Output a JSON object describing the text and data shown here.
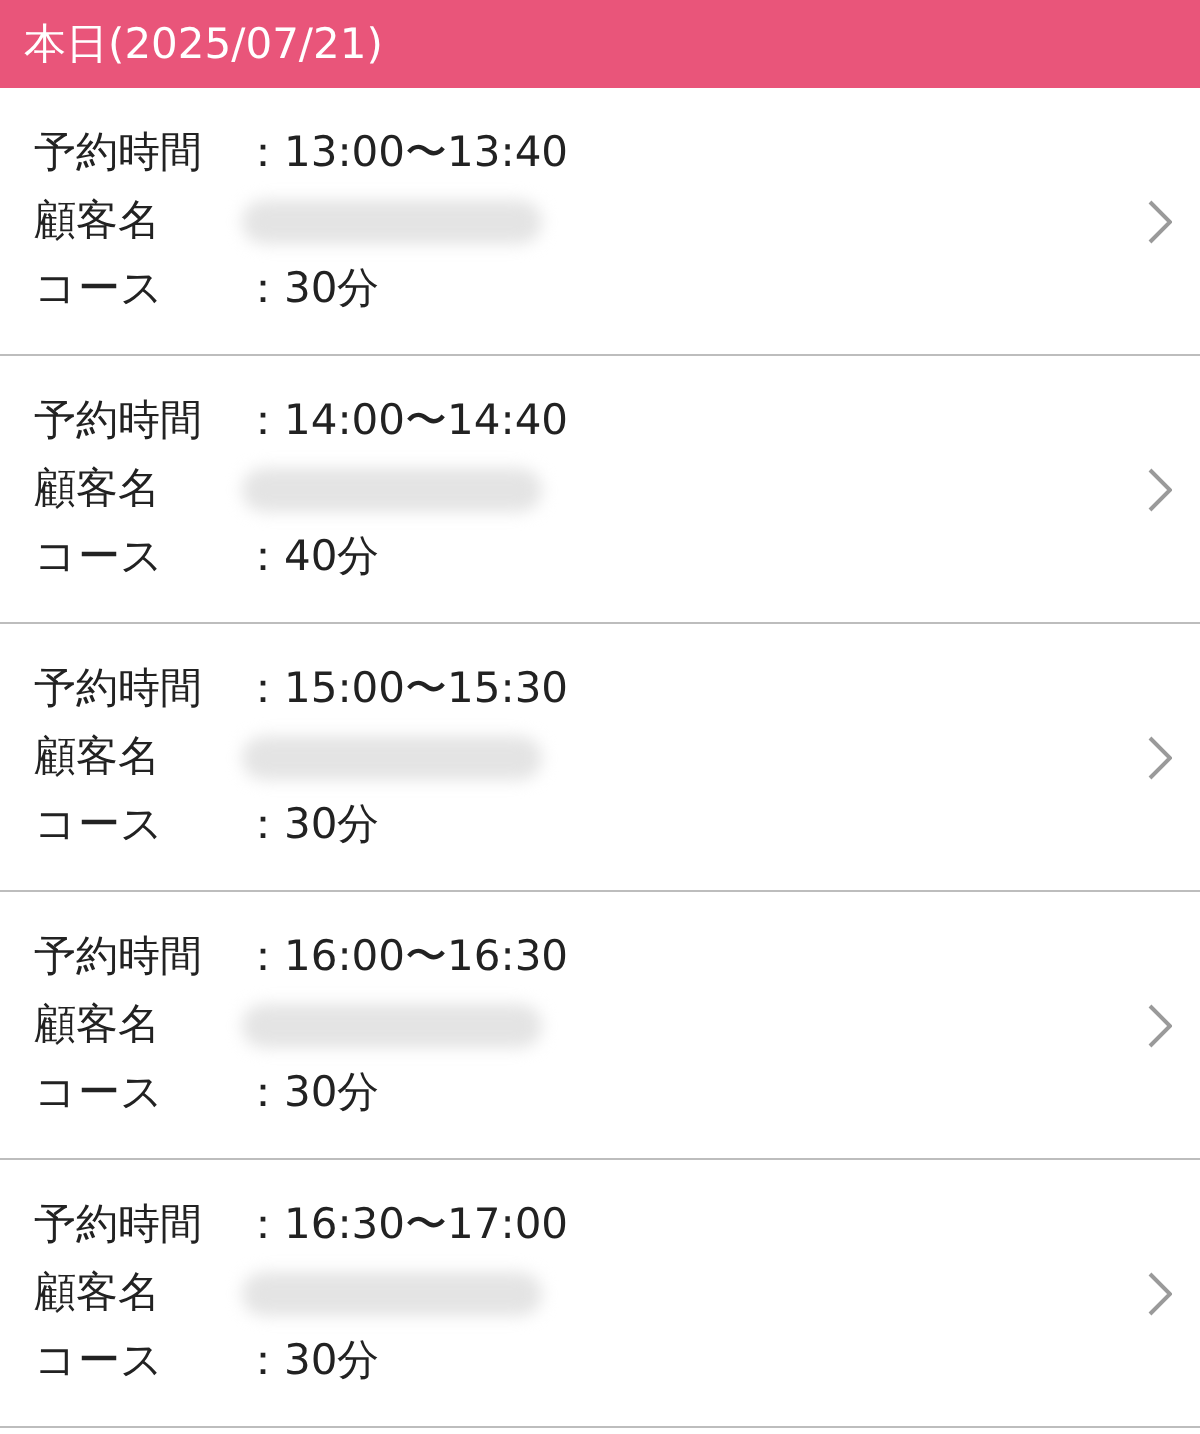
{
  "header": {
    "title": "本日(2025/07/21)"
  },
  "appointments": [
    {
      "time_label": "予約時間",
      "time": "：13:00〜13:40",
      "customer_label": "顧客名",
      "course_label": "コース",
      "course": "：30分"
    },
    {
      "time_label": "予約時間",
      "time": "：14:00〜14:40",
      "customer_label": "顧客名",
      "course_label": "コース",
      "course": "：40分"
    },
    {
      "time_label": "予約時間",
      "time": "：15:00〜15:30",
      "customer_label": "顧客名",
      "course_label": "コース",
      "course": "：30分"
    },
    {
      "time_label": "予約時間",
      "time": "：16:00〜16:30",
      "customer_label": "顧客名",
      "course_label": "コース",
      "course": "：30分"
    },
    {
      "time_label": "予約時間",
      "time": "：16:30〜17:00",
      "customer_label": "顧客名",
      "course_label": "コース",
      "course": "：30分"
    }
  ]
}
